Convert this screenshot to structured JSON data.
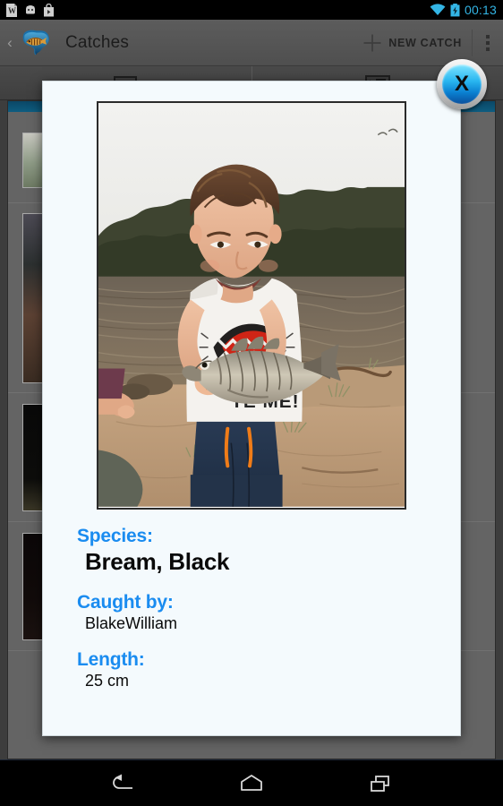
{
  "status_bar": {
    "notification_icons": [
      "word-document-icon",
      "android-robot-icon",
      "play-store-icon"
    ],
    "wifi_icon": "wifi-icon",
    "battery_icon": "battery-charging-icon",
    "clock": "00:13",
    "accent_color": "#33b5e5"
  },
  "action_bar": {
    "back_chevron": "‹",
    "logo_icon": "australia-fish-logo-icon",
    "title": "Catches",
    "new_catch_label": "NEW CATCH",
    "plus_icon": "plus-icon",
    "overflow_icon": "overflow-menu-icon"
  },
  "tabs": [
    {
      "icon": "list-view-tab-icon",
      "label": ""
    },
    {
      "icon": "photo-view-tab-icon",
      "label": ""
    }
  ],
  "background_list": {
    "rows": [
      {
        "thumb": "catch-thumbnail-1"
      },
      {
        "thumb": "catch-thumbnail-2"
      },
      {
        "thumb": "catch-thumbnail-3"
      },
      {
        "thumb": "catch-thumbnail-4"
      }
    ]
  },
  "dialog": {
    "close_label": "X",
    "photo_alt": "boy holding a black bream by a river",
    "details": [
      {
        "label": "Species:",
        "value": "Bream, Black"
      },
      {
        "label": "Caught by:",
        "value": "BlakeWilliam"
      },
      {
        "label": "Length:",
        "value": "25 cm"
      }
    ],
    "label_color": "#1a8cf0"
  },
  "nav_bar": {
    "back_icon": "back-arrow-icon",
    "home_icon": "home-icon",
    "recents_icon": "recent-apps-icon"
  }
}
